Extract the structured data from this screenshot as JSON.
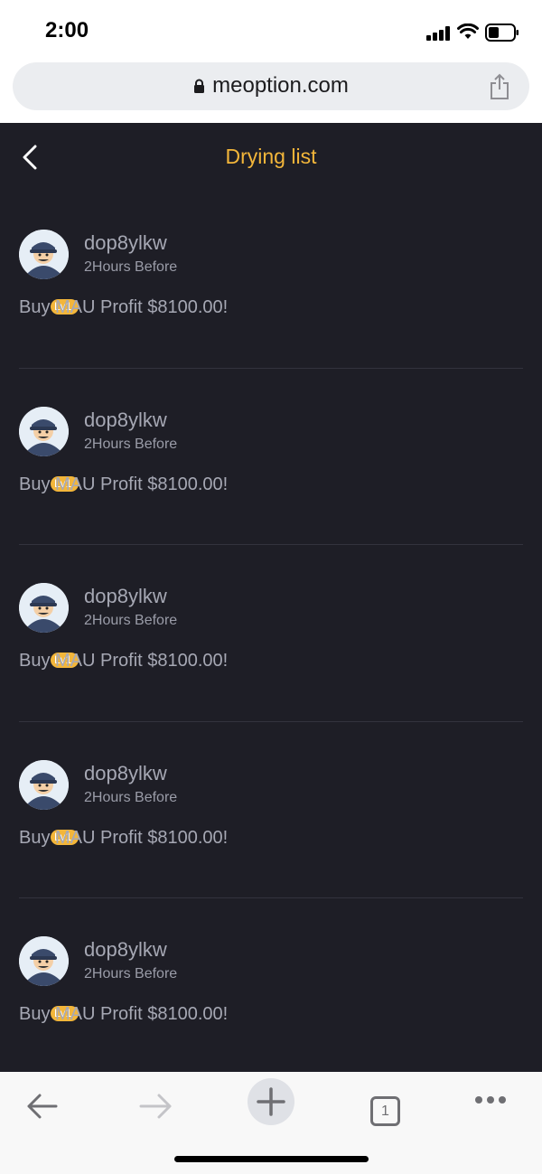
{
  "status": {
    "time": "2:00"
  },
  "browser": {
    "url": "meoption.com",
    "tab_count": "1"
  },
  "header": {
    "title": "Drying list"
  },
  "posts": [
    {
      "username": "dop8ylkw",
      "time": "2Hours Before",
      "level": "Lv1",
      "text": "Buy MAU Profit $8100.00!"
    },
    {
      "username": "dop8ylkw",
      "time": "2Hours Before",
      "level": "Lv1",
      "text": "Buy MAU Profit $8100.00!"
    },
    {
      "username": "dop8ylkw",
      "time": "2Hours Before",
      "level": "Lv1",
      "text": "Buy MAU Profit $8100.00!"
    },
    {
      "username": "dop8ylkw",
      "time": "2Hours Before",
      "level": "Lv1",
      "text": "Buy MAU Profit $8100.00!"
    },
    {
      "username": "dop8ylkw",
      "time": "2Hours Before",
      "level": "Lv1",
      "text": "Buy MAU Profit $8100.00!"
    }
  ],
  "colors": {
    "app_background": "#1e1e26",
    "accent": "#f3b63a",
    "text_muted": "#a6a8b4",
    "divider": "#33333d"
  },
  "icons": {
    "status": [
      "signal-icon",
      "wifi-icon",
      "battery-icon"
    ],
    "url_bar": [
      "lock-icon",
      "share-icon"
    ],
    "header": [
      "back-icon"
    ],
    "toolbar": [
      "back-arrow-icon",
      "forward-arrow-icon",
      "plus-icon",
      "tabs-icon",
      "more-icon"
    ]
  }
}
